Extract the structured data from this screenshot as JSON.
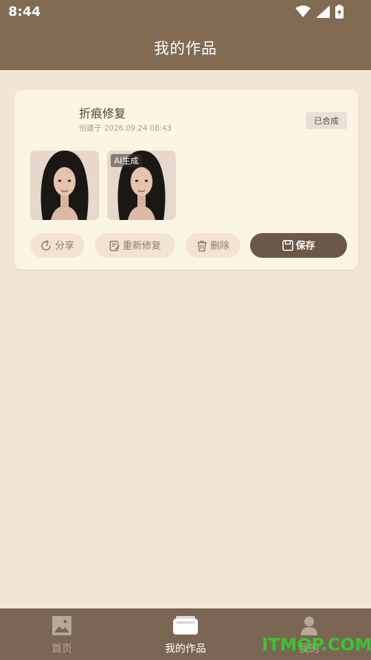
{
  "status_bar": {
    "time": "8:44",
    "icons": [
      "wifi-icon",
      "signal-icon",
      "battery-icon"
    ]
  },
  "header": {
    "title": "我的作品"
  },
  "work_card": {
    "title": "折痕修复",
    "created": "创建于 2026.09.24 08:43",
    "status_badge": "已合成",
    "images": [
      {
        "tag": ""
      },
      {
        "tag": "AI生成"
      }
    ],
    "actions": {
      "share": "分享",
      "redo": "重新修复",
      "delete": "删除",
      "save": "保存"
    }
  },
  "bottom_nav": {
    "items": [
      {
        "label": "首页",
        "icon": "image-icon",
        "active": false
      },
      {
        "label": "我的作品",
        "icon": "folder-icon",
        "active": true
      },
      {
        "label": "我的",
        "icon": "person-icon",
        "active": false
      }
    ]
  },
  "watermark": "ITMOP.COM",
  "colors": {
    "header_bg": "#816b53",
    "page_bg": "#f3e5d3",
    "card_bg": "#fdf5e4",
    "save_button": "#6b5848",
    "nav_bg": "#7b6653",
    "watermark": "#2fd62f"
  }
}
